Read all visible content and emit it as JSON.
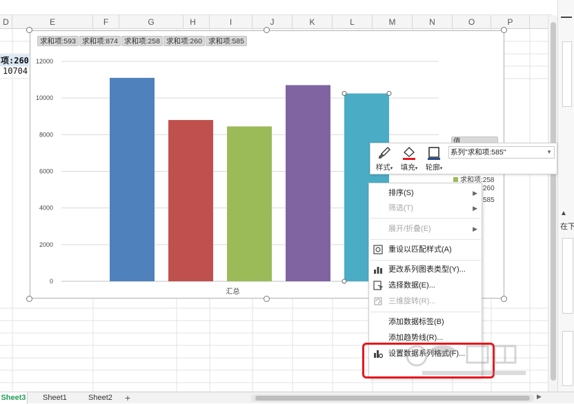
{
  "columns": [
    "D",
    "E",
    "F",
    "G",
    "H",
    "I",
    "J",
    "K",
    "L",
    "M",
    "N",
    "O",
    "P"
  ],
  "cells": {
    "pivot_label": "项:260",
    "pivot_value": "10704"
  },
  "chart": {
    "field_buttons": [
      "求和项:593",
      "求和项:874",
      "求和项:258",
      "求和项:260",
      "求和项:585"
    ],
    "legend_title": "值",
    "legend_items": [
      "求和项:258",
      "260",
      "585"
    ]
  },
  "chart_data": {
    "type": "bar",
    "categories": [
      "汇总"
    ],
    "series": [
      {
        "name": "求和项:593",
        "values": [
          11100
        ],
        "color": "#4f81bd"
      },
      {
        "name": "求和项:874",
        "values": [
          8800
        ],
        "color": "#c0504d"
      },
      {
        "name": "求和项:258",
        "values": [
          8450
        ],
        "color": "#9bbb59"
      },
      {
        "name": "求和项:260",
        "values": [
          10704
        ],
        "color": "#8064a2"
      },
      {
        "name": "求和项:585",
        "values": [
          10250
        ],
        "color": "#4bacc6"
      }
    ],
    "yticks": [
      "0",
      "2000",
      "4000",
      "6000",
      "8000",
      "10000",
      "12000"
    ],
    "ylim": [
      0,
      12000
    ],
    "grid": true
  },
  "format_toolbar": {
    "style_label": "样式",
    "fill_label": "填充",
    "outline_label": "轮廓",
    "series_select": "系列\"求和项:585\""
  },
  "context_menu": {
    "sort": "排序(S)",
    "filter": "筛选(T)",
    "expand": "展开/折叠(E)",
    "reset_style": "重设以匹配样式(A)",
    "change_type": "更改系列图表类型(Y)...",
    "select_data": "选择数据(E)...",
    "rotate_3d": "三维旋转(R)...",
    "add_labels": "添加数据标签(B)",
    "add_trendline": "添加趋势线(R)...",
    "format_series": "设置数据系列格式(F)..."
  },
  "right_panel": {
    "label_1": "在下"
  },
  "tabs": [
    "Sheet3",
    "Sheet1",
    "Sheet2"
  ],
  "add_tab": "+",
  "colors": {
    "accent": "#1f9d55",
    "highlight": "#e8141b"
  }
}
